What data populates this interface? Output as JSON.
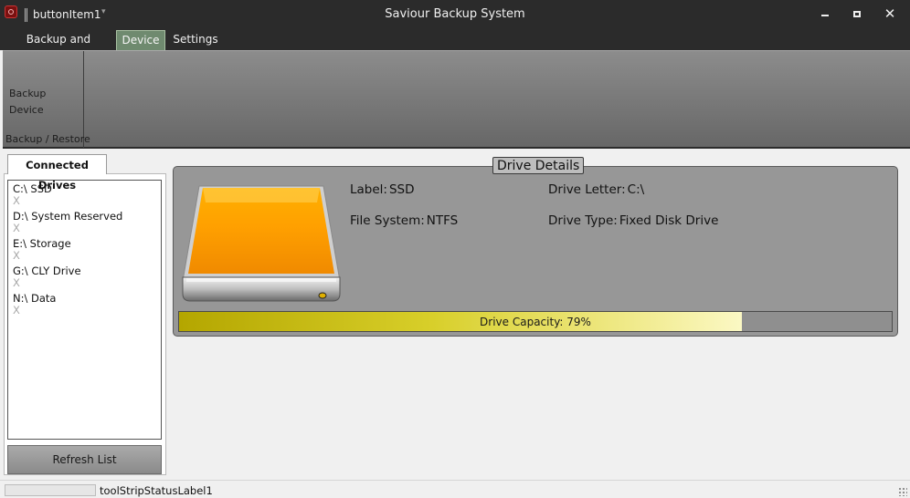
{
  "window": {
    "title": "Saviour Backup System",
    "quick_access_item": "buttonItem1",
    "quick_access_dropdown": "▾",
    "controls": {
      "minimize": "",
      "maximize": "",
      "close": "✕"
    }
  },
  "ribbon": {
    "tabs": [
      {
        "label": "Backup and Restore",
        "active": false
      },
      {
        "label": "Device",
        "active": true
      },
      {
        "label": "Settings",
        "active": false
      }
    ],
    "group": {
      "button_label": "Backup Device",
      "group_label": "Backup / Restore"
    }
  },
  "connected_drives": {
    "tab_label": "Connected Drives",
    "drives": [
      {
        "name": "C:\\ SSD",
        "remove": "X"
      },
      {
        "name": "D:\\ System Reserved",
        "remove": "X"
      },
      {
        "name": "E:\\ Storage",
        "remove": "X"
      },
      {
        "name": "G:\\ CLY Drive",
        "remove": "X"
      },
      {
        "name": "N:\\ Data",
        "remove": "X"
      }
    ],
    "refresh_label": "Refresh List"
  },
  "drive_details": {
    "title": "Drive Details",
    "label_key": "Label:",
    "label_value": "SSD",
    "letter_key": "Drive Letter:",
    "letter_value": "C:\\",
    "fs_key": "File System:",
    "fs_value": "NTFS",
    "type_key": "Drive Type:",
    "type_value": "Fixed Disk Drive",
    "capacity_text": "Drive Capacity: 79%",
    "capacity_fraction": 0.79,
    "capacity_color": "#d8cf2a",
    "icon": "hard-drive-icon"
  },
  "status_bar": {
    "label": "toolStripStatusLabel1"
  },
  "colors": {
    "titlebar": "#2b2b2b",
    "active_tab": "#6f8a6f",
    "ribbon": "#7a7a7a",
    "details_panel": "#979797"
  }
}
